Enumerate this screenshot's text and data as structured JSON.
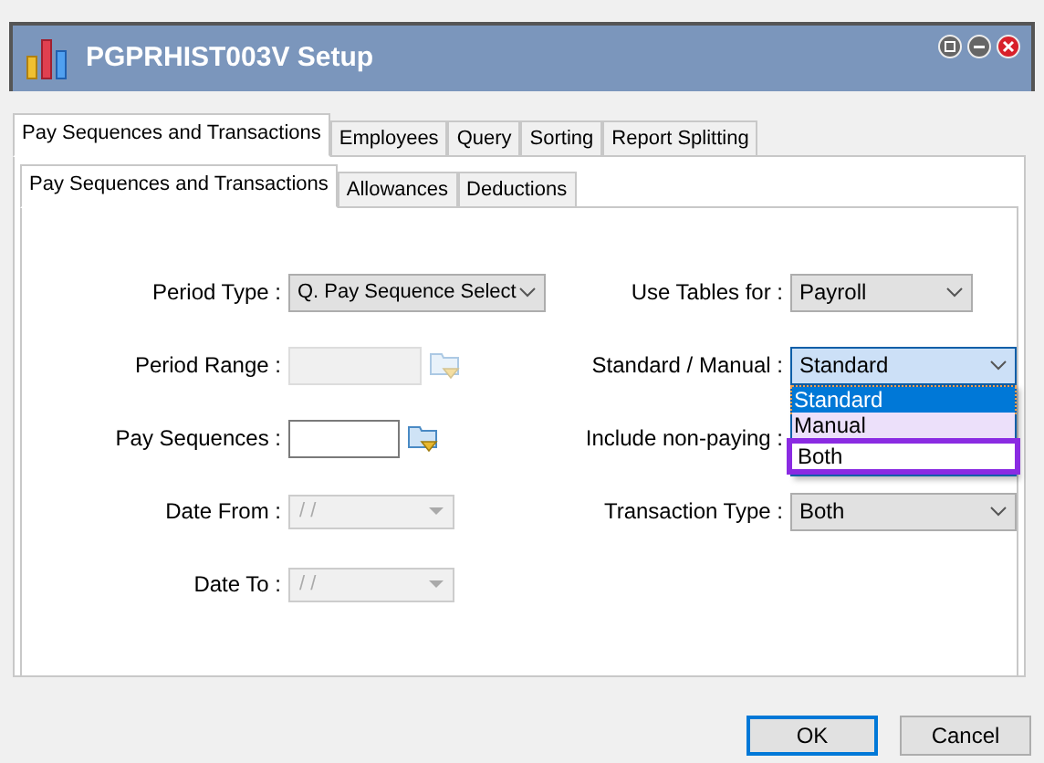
{
  "window": {
    "title": "PGPRHIST003V Setup"
  },
  "tabs": [
    {
      "label": "Pay Sequences and Transactions",
      "selected": true
    },
    {
      "label": "Employees",
      "selected": false
    },
    {
      "label": "Query",
      "selected": false
    },
    {
      "label": "Sorting",
      "selected": false
    },
    {
      "label": "Report Splitting",
      "selected": false
    }
  ],
  "subtabs": [
    {
      "label": "Pay Sequences and Transactions",
      "selected": true
    },
    {
      "label": "Allowances",
      "selected": false
    },
    {
      "label": "Deductions",
      "selected": false
    }
  ],
  "left_fields": [
    {
      "label": "Period Type :",
      "kind": "combo",
      "value": "Q. Pay Sequence Select",
      "disabled": false
    },
    {
      "label": "Period Range :",
      "kind": "picker",
      "disabled": true
    },
    {
      "label": "Pay Sequences :",
      "kind": "picker",
      "disabled": false
    },
    {
      "label": "Date From :",
      "kind": "date",
      "value": "/ /",
      "disabled": true
    },
    {
      "label": "Date To :",
      "kind": "date",
      "value": "/ /",
      "disabled": true
    }
  ],
  "right_fields": [
    {
      "label": "Use Tables for :",
      "kind": "combo",
      "value": "Payroll",
      "open": false
    },
    {
      "label": "Standard / Manual :",
      "kind": "combo",
      "value": "Standard",
      "open": true
    },
    {
      "label": "Include non-paying :",
      "kind": "hidden"
    },
    {
      "label": "Transaction Type :",
      "kind": "combo",
      "value": "Both",
      "open": false
    }
  ],
  "dropdown": {
    "options": [
      {
        "label": "Standard",
        "selected": true,
        "hovered": false,
        "outlined": false
      },
      {
        "label": "Manual",
        "selected": false,
        "hovered": true,
        "outlined": false
      },
      {
        "label": "Both",
        "selected": false,
        "hovered": false,
        "outlined": true
      }
    ]
  },
  "buttons": [
    {
      "label": "OK",
      "default": true
    },
    {
      "label": "Cancel",
      "default": false
    }
  ]
}
